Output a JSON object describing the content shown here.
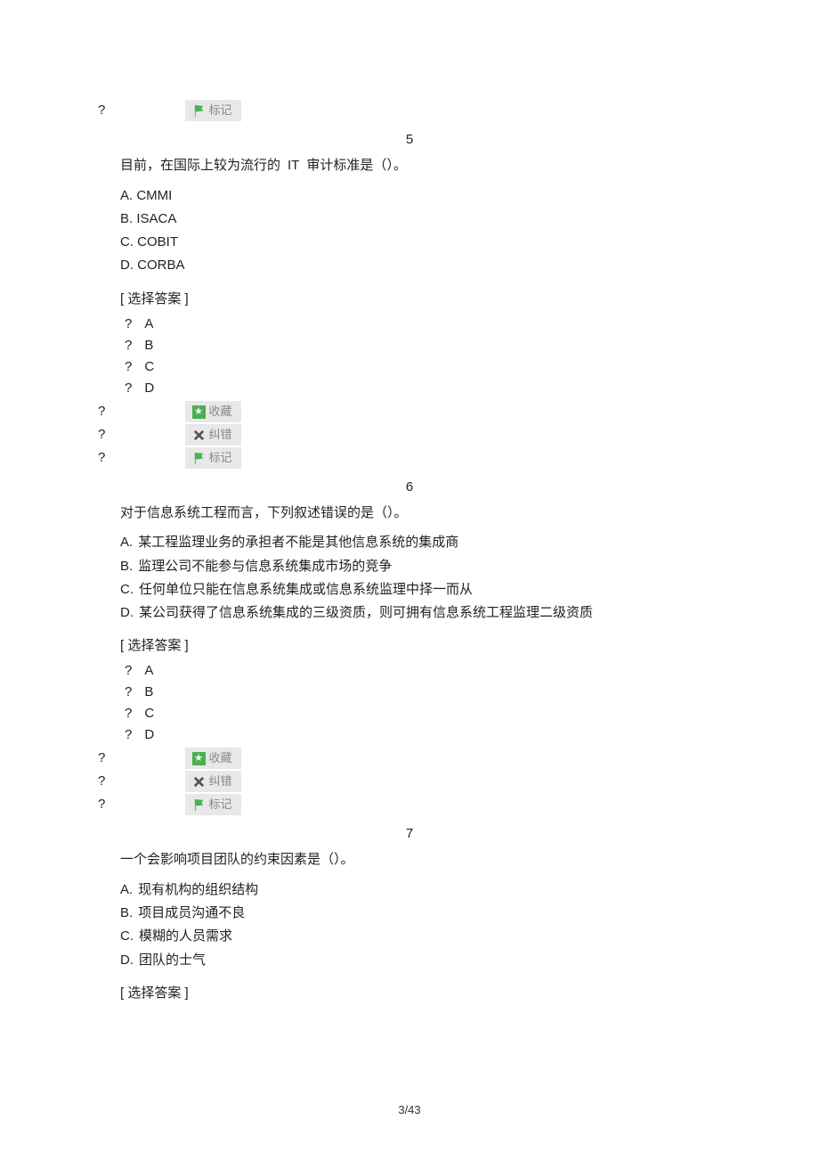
{
  "qmark": "?",
  "btn_flag": "标记",
  "btn_fav": "收藏",
  "btn_err": "纠错",
  "select_label": "[ 选择答案 ]",
  "ans_a": "A",
  "ans_b": "B",
  "ans_c": "C",
  "ans_d": "D",
  "q5": {
    "num": "5",
    "text_1": "目前，在国际上较为流行的",
    "text_it": "IT",
    "text_2": "审计标准是（）。",
    "a": "A. CMMI",
    "b": "B. ISACA",
    "c": "C. COBIT",
    "d": "D. CORBA"
  },
  "q6": {
    "num": "6",
    "text": "对于信息系统工程而言，下列叙述错误的是（）。",
    "a_l": "A.",
    "a_t": "某工程监理业务的承担者不能是其他信息系统的集成商",
    "b_l": "B.",
    "b_t": "监理公司不能参与信息系统集成市场的竞争",
    "c_l": "C.",
    "c_t": "任何单位只能在信息系统集成或信息系统监理中择一而从",
    "d_l": "D.",
    "d_t": "某公司获得了信息系统集成的三级资质，则可拥有信息系统工程监理二级资质"
  },
  "q7": {
    "num": "7",
    "text": "一个会影响项目团队的约束因素是（）。",
    "a_l": "A.",
    "a_t": "现有机构的组织结构",
    "b_l": "B.",
    "b_t": "项目成员沟通不良",
    "c_l": "C.",
    "c_t": "模糊的人员需求",
    "d_l": "D.",
    "d_t": "团队的士气"
  },
  "page": "3/43"
}
